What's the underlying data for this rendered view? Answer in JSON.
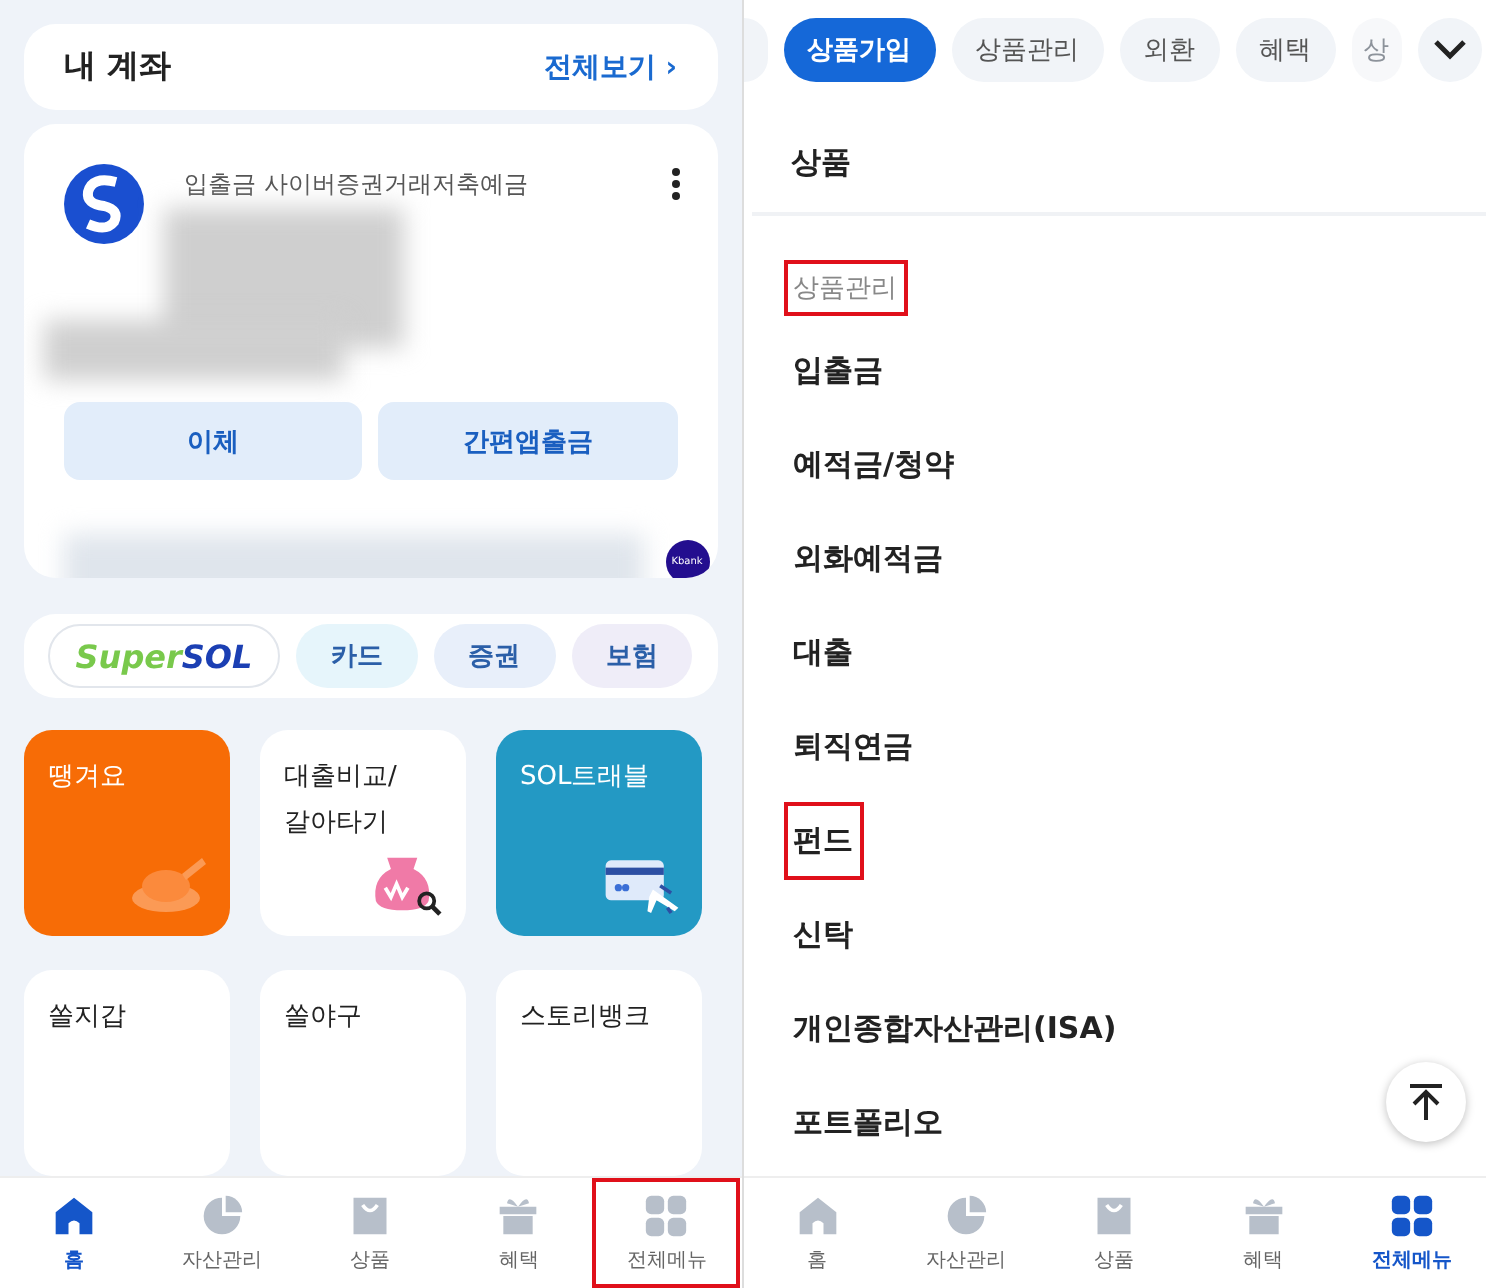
{
  "left": {
    "accounts_card": {
      "title": "내 계좌",
      "link": "전체보기 ›"
    },
    "account": {
      "name": "입출금 사이버증권거래저축예금",
      "buttons": [
        "이체",
        "간편앱출금"
      ],
      "other_bank_logo": "Kbank"
    },
    "super_sol": {
      "logo_part_1": "Super",
      "logo_part_2": "SOL"
    },
    "quick_chips": [
      {
        "label": "카드",
        "color": "#e6f5fb"
      },
      {
        "label": "증권",
        "color": "#e8effa"
      },
      {
        "label": "보험",
        "color": "#efedf8"
      }
    ],
    "tiles": [
      {
        "label": "땡겨요",
        "kind": "food",
        "color": "#f76c06"
      },
      {
        "label": "대출비교/\n갈아타기",
        "kind": "loan",
        "color": "#ffffff"
      },
      {
        "label": "SOL트래블",
        "kind": "travel",
        "color": "#2399c4"
      },
      {
        "label": "쏠지갑",
        "kind": "plain",
        "color": "#ffffff"
      },
      {
        "label": "쏠야구",
        "kind": "plain",
        "color": "#ffffff"
      },
      {
        "label": "스토리뱅크",
        "kind": "plain",
        "color": "#ffffff"
      }
    ],
    "nav": [
      {
        "label": "홈",
        "kind": "home",
        "selected": true,
        "highlighted": false
      },
      {
        "label": "자산관리",
        "kind": "chart",
        "selected": false,
        "highlighted": false
      },
      {
        "label": "상품",
        "kind": "bag",
        "selected": false,
        "highlighted": false
      },
      {
        "label": "혜택",
        "kind": "gift",
        "selected": false,
        "highlighted": false
      },
      {
        "label": "전체메뉴",
        "kind": "grid",
        "selected": false,
        "highlighted": true
      }
    ]
  },
  "right": {
    "tabs": [
      {
        "label": "상품가입",
        "selected": true
      },
      {
        "label": "상품관리",
        "selected": false
      },
      {
        "label": "외환",
        "selected": false
      },
      {
        "label": "혜택",
        "selected": false
      },
      {
        "label": "상",
        "selected": false
      }
    ],
    "section_title": "상품",
    "group_title": {
      "label": "상품관리",
      "highlighted": true
    },
    "menu_items": [
      {
        "label": "입출금",
        "highlighted": false
      },
      {
        "label": "예적금/청약",
        "highlighted": false
      },
      {
        "label": "외화예적금",
        "highlighted": false
      },
      {
        "label": "대출",
        "highlighted": false
      },
      {
        "label": "퇴직연금",
        "highlighted": false
      },
      {
        "label": "펀드",
        "highlighted": true
      },
      {
        "label": "신탁",
        "highlighted": false
      },
      {
        "label": "개인종합자산관리(ISA)",
        "highlighted": false
      },
      {
        "label": "포트폴리오",
        "highlighted": false
      }
    ],
    "nav": [
      {
        "label": "홈",
        "kind": "home",
        "selected": false,
        "highlighted": false
      },
      {
        "label": "자산관리",
        "kind": "chart",
        "selected": false,
        "highlighted": false
      },
      {
        "label": "상품",
        "kind": "bag",
        "selected": false,
        "highlighted": false
      },
      {
        "label": "혜택",
        "kind": "gift",
        "selected": false,
        "highlighted": false
      },
      {
        "label": "전체메뉴",
        "kind": "grid",
        "selected": true,
        "highlighted": false
      }
    ]
  }
}
